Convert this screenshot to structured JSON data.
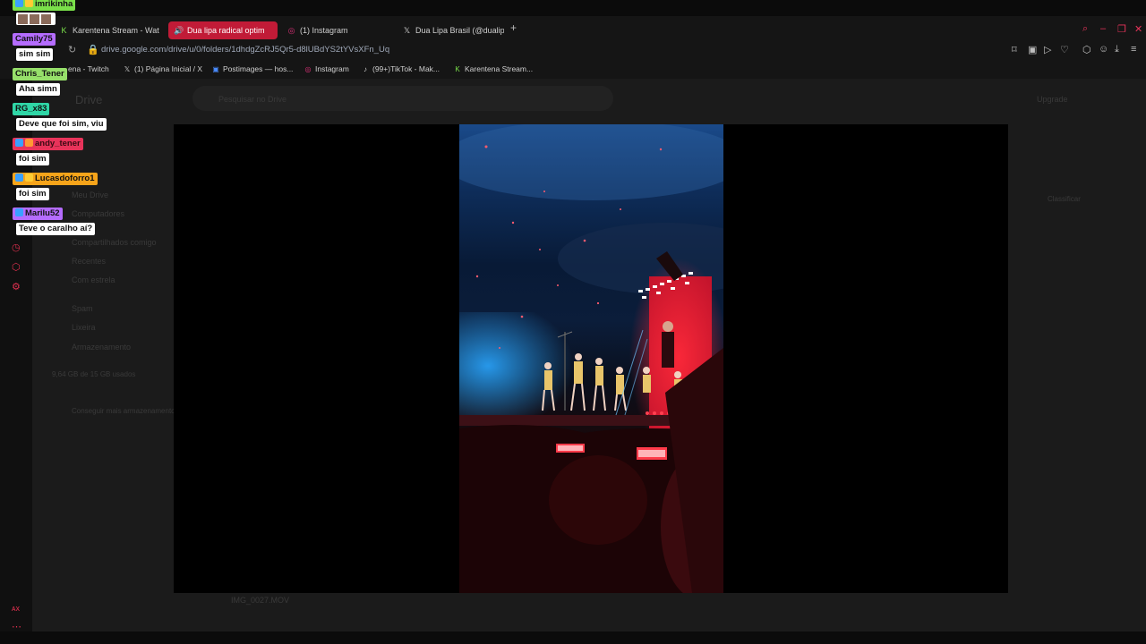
{
  "browser": {
    "tabs": [
      {
        "label": "Karentena Stream - Watc",
        "favicon": "karentena-icon",
        "active": false
      },
      {
        "label": "Dua lipa radical optim",
        "favicon": "google-drive-icon",
        "active": true
      },
      {
        "label": "(1) Instagram",
        "favicon": "instagram-icon",
        "active": false
      },
      {
        "label": "Dua Lipa Brasil (@dualipa",
        "favicon": "x-icon",
        "active": false
      }
    ],
    "new_tab": "+",
    "url": "drive.google.com/drive/u/0/folders/1dhdgZcRJ5Qr5-d8lUBdYS2tYVsXFn_Uq",
    "bookmarks": [
      {
        "label": "ena - Twitch",
        "favicon": ""
      },
      {
        "label": "(1) Página Inicial / X",
        "favicon": "x-icon"
      },
      {
        "label": "Postimages — hos...",
        "favicon": "postimages-icon"
      },
      {
        "label": "Instagram",
        "favicon": "instagram-icon"
      },
      {
        "label": "(99+)TikTok - Mak...",
        "favicon": "tiktok-icon"
      },
      {
        "label": "Karentena Stream...",
        "favicon": "karentena-icon"
      }
    ],
    "accent": "#c11b37"
  },
  "drive": {
    "logo_text": "Drive",
    "search_placeholder": "Pesquisar no Drive",
    "upgrade": "Upgrade",
    "nav": [
      "Meu Drive",
      "Computadores",
      "Compartilhados comigo",
      "Recentes",
      "Com estrela",
      "Spam",
      "Lixeira",
      "Armazenamento"
    ],
    "storage": "9,64 GB de 15 GB usados",
    "get_more": "Conseguir mais armazenamento",
    "sort_label": "Classificar",
    "file_name": "IMG_0027.MOV"
  },
  "chat": [
    {
      "user": "imrikinha",
      "color": "#7ae04a",
      "message": ""
    },
    {
      "user": "Camily75",
      "color": "#b56cff",
      "message": "sim sim"
    },
    {
      "user": "Chris_Tener",
      "color": "#96e06a",
      "message": "Aha simn"
    },
    {
      "user": "RG_x83",
      "color": "#2fd6a6",
      "message": "Deve que foi sim, viu"
    },
    {
      "user": "andy_tener",
      "color": "#e8335a",
      "message": "foi sim"
    },
    {
      "user": "Lucasdoforro1",
      "color": "#f6a41a",
      "message": "foi sim"
    },
    {
      "user": "Marilu52",
      "color": "#b56cff",
      "message": "Teve o caralho aí?"
    }
  ],
  "video": {
    "file": "IMG_0027.MOV",
    "scene": "concert-stage"
  }
}
